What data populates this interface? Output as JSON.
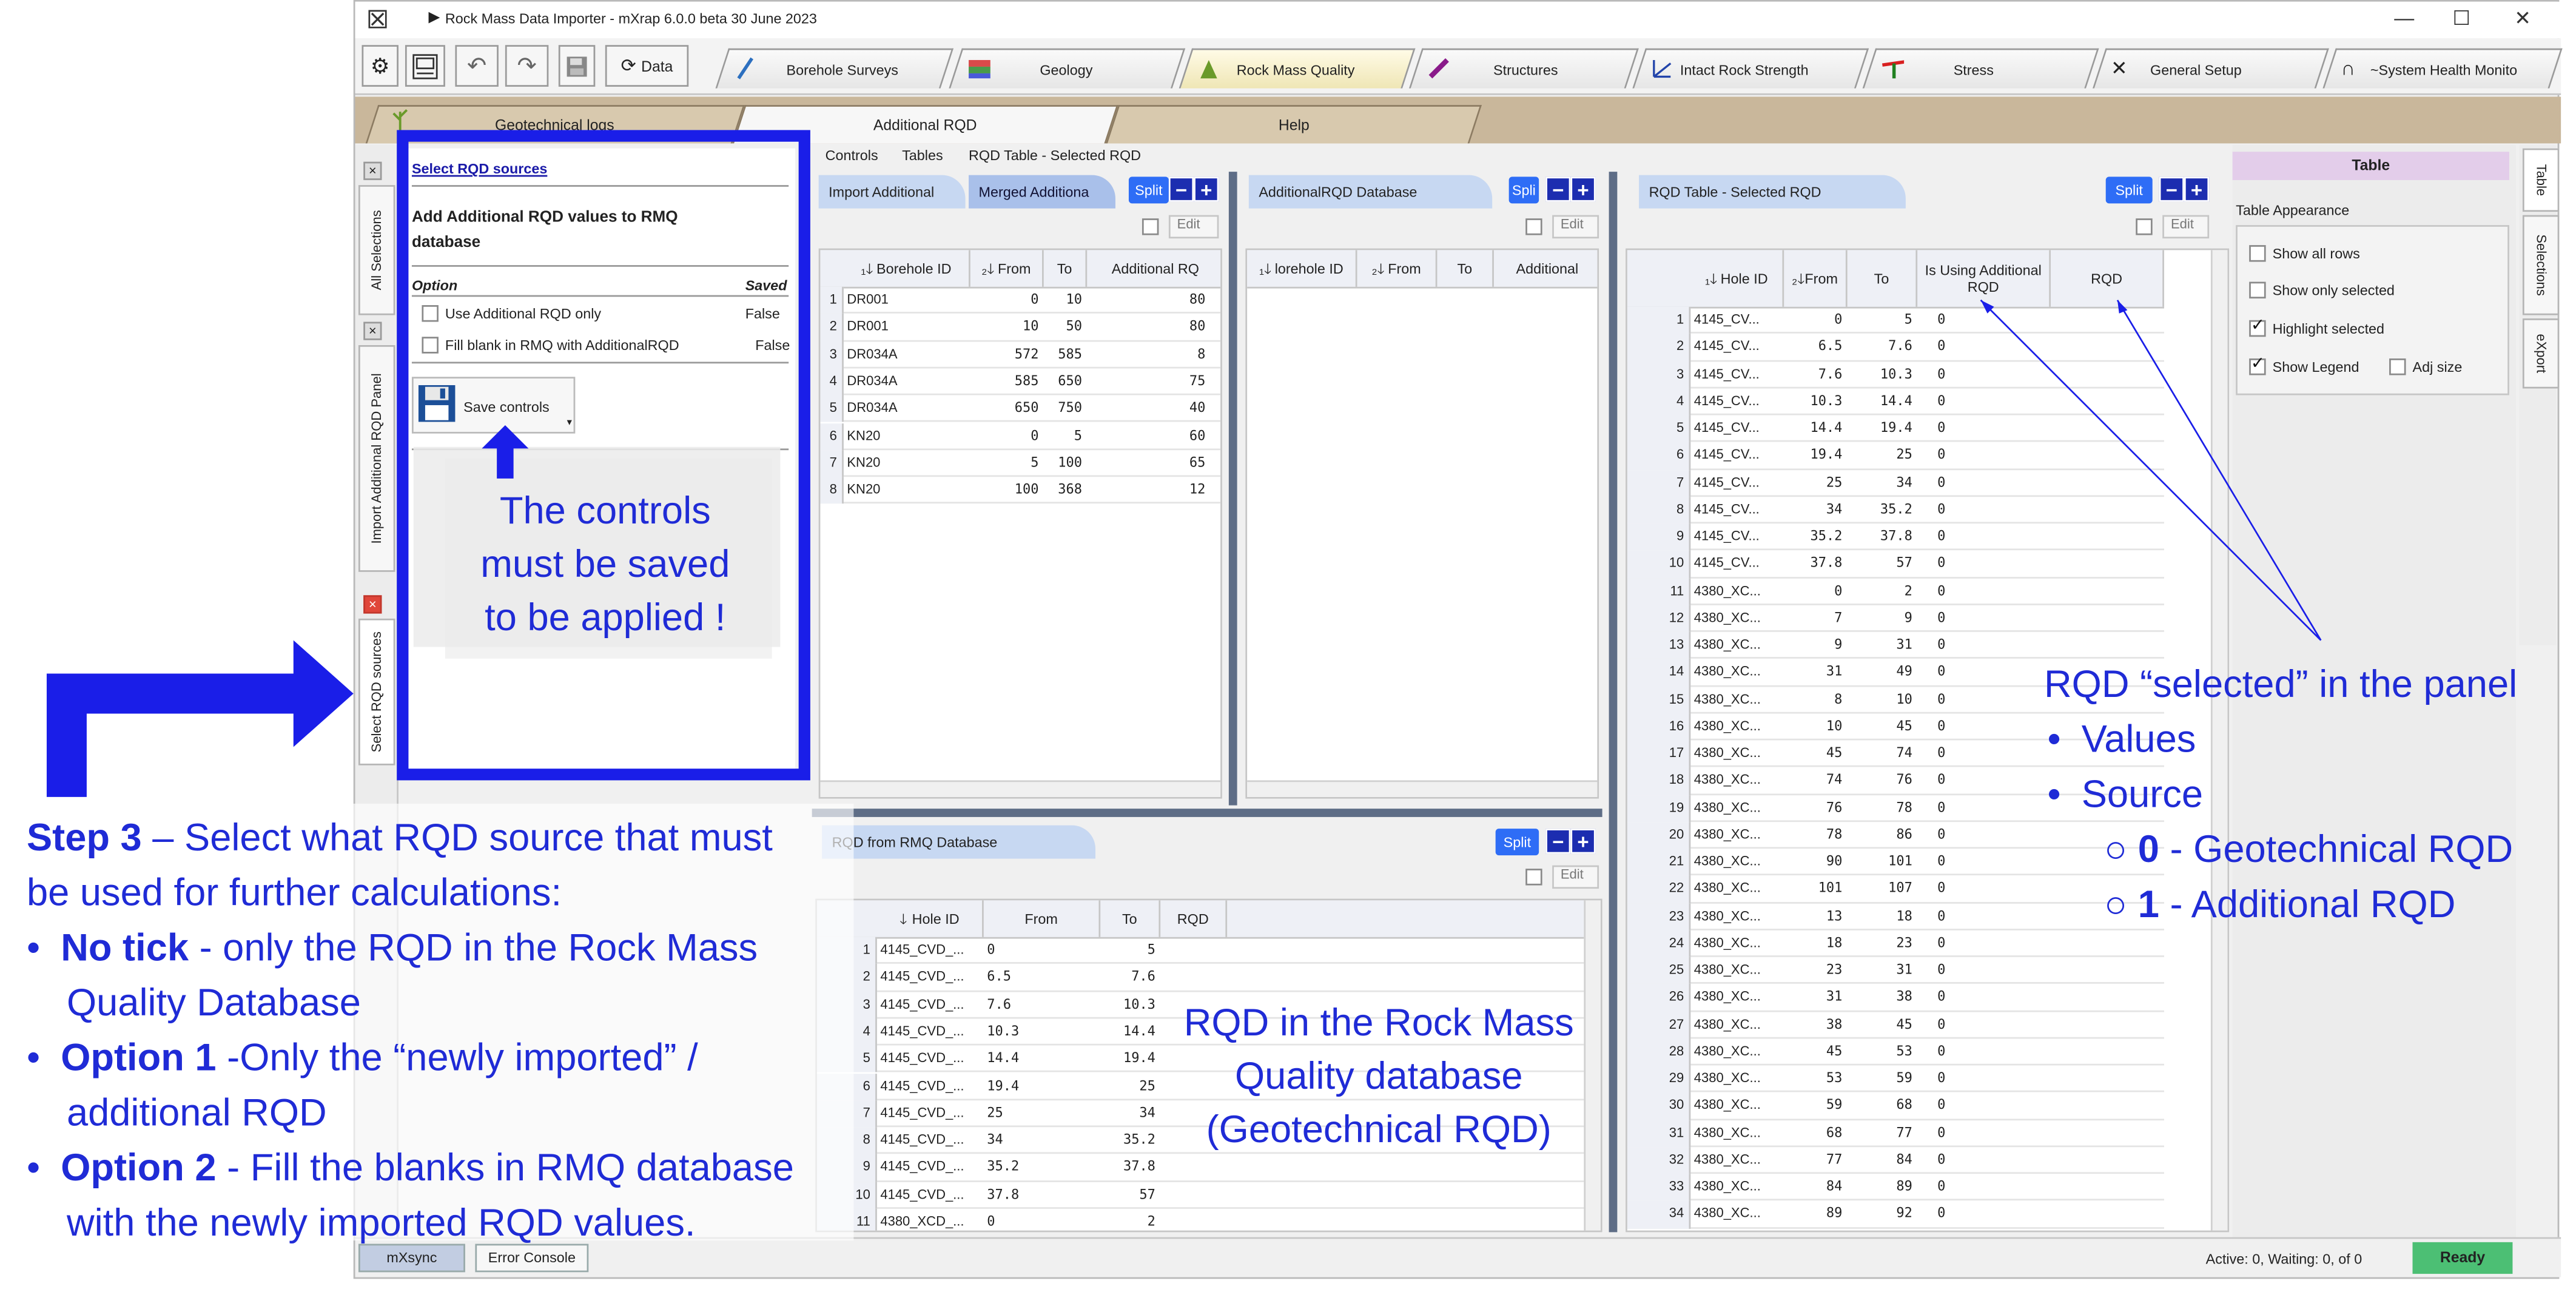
{
  "window": {
    "title": "Rock Mass Data Importer  - mXrap 6.0.0 beta 30 June 2023",
    "controls": {
      "minimize": "—",
      "maximize": "☐",
      "close": "✕"
    }
  },
  "toolbar": {
    "data_label": "Data",
    "main_tabs": [
      "Borehole Surveys",
      "Geology",
      "Rock Mass Quality",
      "Structures",
      "Intact Rock Strength",
      "Stress",
      "General Setup",
      "~System Health Monito"
    ]
  },
  "sub_tabs": [
    "Geotechnical logs",
    "Additional RQD",
    "Help"
  ],
  "menu": [
    "Controls",
    "Tables",
    "RQD Table - Selected RQD"
  ],
  "side_tabs": [
    "All Selections",
    "Import Additional RQD Panel",
    "Select RQD sources"
  ],
  "controls_panel": {
    "link": "Select RQD sources",
    "heading": "Add Additional RQD values to RMQ database",
    "col_option": "Option",
    "col_saved": "Saved",
    "options": [
      {
        "label": "Use Additional RQD only",
        "saved": "False"
      },
      {
        "label": "Fill blank in RMQ with AdditionalRQD",
        "saved": "False"
      }
    ],
    "save_label": "Save controls"
  },
  "import_grid": {
    "tab1": "Import Additional",
    "tab2": "Merged Additiona",
    "split": "Split",
    "edit": "Edit",
    "headers": [
      "Borehole ID",
      "From",
      "To",
      "Additional RQ"
    ],
    "rows": [
      [
        "1",
        "DR001",
        "0",
        "10",
        "80"
      ],
      [
        "2",
        "DR001",
        "10",
        "50",
        "80"
      ],
      [
        "3",
        "DR034A",
        "572",
        "585",
        "8"
      ],
      [
        "4",
        "DR034A",
        "585",
        "650",
        "75"
      ],
      [
        "5",
        "DR034A",
        "650",
        "750",
        "40"
      ],
      [
        "6",
        "KN20",
        "0",
        "5",
        "60"
      ],
      [
        "7",
        "KN20",
        "5",
        "100",
        "65"
      ],
      [
        "8",
        "KN20",
        "100",
        "368",
        "12"
      ]
    ]
  },
  "addl_db_grid": {
    "title": "AdditionalRQD Database",
    "split": "Spli",
    "edit": "Edit",
    "headers": [
      "lorehole ID",
      "From",
      "To",
      "Additional"
    ]
  },
  "rmq_grid": {
    "title": "RQD from RMQ Database",
    "split": "Split",
    "edit": "Edit",
    "headers": [
      "Hole ID",
      "From",
      "To",
      "RQD"
    ],
    "rows": [
      [
        "1",
        "4145_CVD_...",
        "0",
        "5"
      ],
      [
        "2",
        "4145_CVD_...",
        "6.5",
        "7.6"
      ],
      [
        "3",
        "4145_CVD_...",
        "7.6",
        "10.3"
      ],
      [
        "4",
        "4145_CVD_...",
        "10.3",
        "14.4"
      ],
      [
        "5",
        "4145_CVD_...",
        "14.4",
        "19.4"
      ],
      [
        "6",
        "4145_CVD_...",
        "19.4",
        "25"
      ],
      [
        "7",
        "4145_CVD_...",
        "25",
        "34"
      ],
      [
        "8",
        "4145_CVD_...",
        "34",
        "35.2"
      ],
      [
        "9",
        "4145_CVD_...",
        "35.2",
        "37.8"
      ],
      [
        "10",
        "4145_CVD_...",
        "37.8",
        "57"
      ],
      [
        "11",
        "4380_XCD_...",
        "0",
        "2"
      ]
    ]
  },
  "selected_grid": {
    "title": "RQD Table - Selected RQD",
    "split": "Split",
    "edit": "Edit",
    "headers": [
      "Hole ID",
      "From",
      "To",
      "Is Using Additional RQD",
      "RQD"
    ],
    "rows": [
      [
        "1",
        "4145_CV...",
        "0",
        "5",
        "0"
      ],
      [
        "2",
        "4145_CV...",
        "6.5",
        "7.6",
        "0"
      ],
      [
        "3",
        "4145_CV...",
        "7.6",
        "10.3",
        "0"
      ],
      [
        "4",
        "4145_CV...",
        "10.3",
        "14.4",
        "0"
      ],
      [
        "5",
        "4145_CV...",
        "14.4",
        "19.4",
        "0"
      ],
      [
        "6",
        "4145_CV...",
        "19.4",
        "25",
        "0"
      ],
      [
        "7",
        "4145_CV...",
        "25",
        "34",
        "0"
      ],
      [
        "8",
        "4145_CV...",
        "34",
        "35.2",
        "0"
      ],
      [
        "9",
        "4145_CV...",
        "35.2",
        "37.8",
        "0"
      ],
      [
        "10",
        "4145_CV...",
        "37.8",
        "57",
        "0"
      ],
      [
        "11",
        "4380_XC...",
        "0",
        "2",
        "0"
      ],
      [
        "12",
        "4380_XC...",
        "7",
        "9",
        "0"
      ],
      [
        "13",
        "4380_XC...",
        "9",
        "31",
        "0"
      ],
      [
        "14",
        "4380_XC...",
        "31",
        "49",
        "0"
      ],
      [
        "15",
        "4380_XC...",
        "8",
        "10",
        "0"
      ],
      [
        "16",
        "4380_XC...",
        "10",
        "45",
        "0"
      ],
      [
        "17",
        "4380_XC...",
        "45",
        "74",
        "0"
      ],
      [
        "18",
        "4380_XC...",
        "74",
        "76",
        "0"
      ],
      [
        "19",
        "4380_XC...",
        "76",
        "78",
        "0"
      ],
      [
        "20",
        "4380_XC...",
        "78",
        "86",
        "0"
      ],
      [
        "21",
        "4380_XC...",
        "90",
        "101",
        "0"
      ],
      [
        "22",
        "4380_XC...",
        "101",
        "107",
        "0"
      ],
      [
        "23",
        "4380_XC...",
        "13",
        "18",
        "0"
      ],
      [
        "24",
        "4380_XC...",
        "18",
        "23",
        "0"
      ],
      [
        "25",
        "4380_XC...",
        "23",
        "31",
        "0"
      ],
      [
        "26",
        "4380_XC...",
        "31",
        "38",
        "0"
      ],
      [
        "27",
        "4380_XC...",
        "38",
        "45",
        "0"
      ],
      [
        "28",
        "4380_XC...",
        "45",
        "53",
        "0"
      ],
      [
        "29",
        "4380_XC...",
        "53",
        "59",
        "0"
      ],
      [
        "30",
        "4380_XC...",
        "59",
        "68",
        "0"
      ],
      [
        "31",
        "4380_XC...",
        "68",
        "77",
        "0"
      ],
      [
        "32",
        "4380_XC...",
        "77",
        "84",
        "0"
      ],
      [
        "33",
        "4380_XC...",
        "84",
        "89",
        "0"
      ],
      [
        "34",
        "4380_XC...",
        "89",
        "92",
        "0"
      ]
    ]
  },
  "table_panel": {
    "title": "Table",
    "appearance": "Table Appearance",
    "options": [
      {
        "label": "Show all rows",
        "checked": false
      },
      {
        "label": "Show only selected",
        "checked": false
      },
      {
        "label": "Highlight selected",
        "checked": true
      },
      {
        "label": "Show Legend",
        "checked": true
      },
      {
        "label": "Adj size",
        "checked": false
      }
    ],
    "right_tabs": [
      "Table",
      "Selections",
      "eXport"
    ]
  },
  "status": {
    "mxsync": "mXsync",
    "error_console": "Error Console",
    "active": "Active: 0, Waiting:  0, of  0",
    "ready": "Ready"
  },
  "annotations": {
    "controls_note": [
      "The controls",
      "must be saved",
      "to be applied !"
    ],
    "rmq_note": [
      "RQD in the Rock Mass",
      "Quality database",
      "(Geotechnical RQD)"
    ],
    "selected_note": {
      "title": "RQD “selected” in the panel",
      "bullets": [
        "Values",
        "Source"
      ],
      "sub_bullets": [
        {
          "num": "0",
          "text": " - Geotechnical RQD"
        },
        {
          "num": "1",
          "text": " - Additional RQD"
        }
      ]
    },
    "step3": {
      "lead_bold": "Step 3",
      "lead_rest": " – Select what RQD source that must",
      "lead_line2": "be used for further calculations:",
      "items": [
        {
          "bold": "No tick",
          "rest": " - only the RQD in the Rock Mass",
          "cont": "Quality Database"
        },
        {
          "bold": "Option 1",
          "rest": " -Only the “newly imported” /",
          "cont": "additional RQD"
        },
        {
          "bold": "Option 2",
          "rest": " - Fill the blanks in RMQ database",
          "cont": "with the newly imported RQD values."
        }
      ]
    }
  }
}
